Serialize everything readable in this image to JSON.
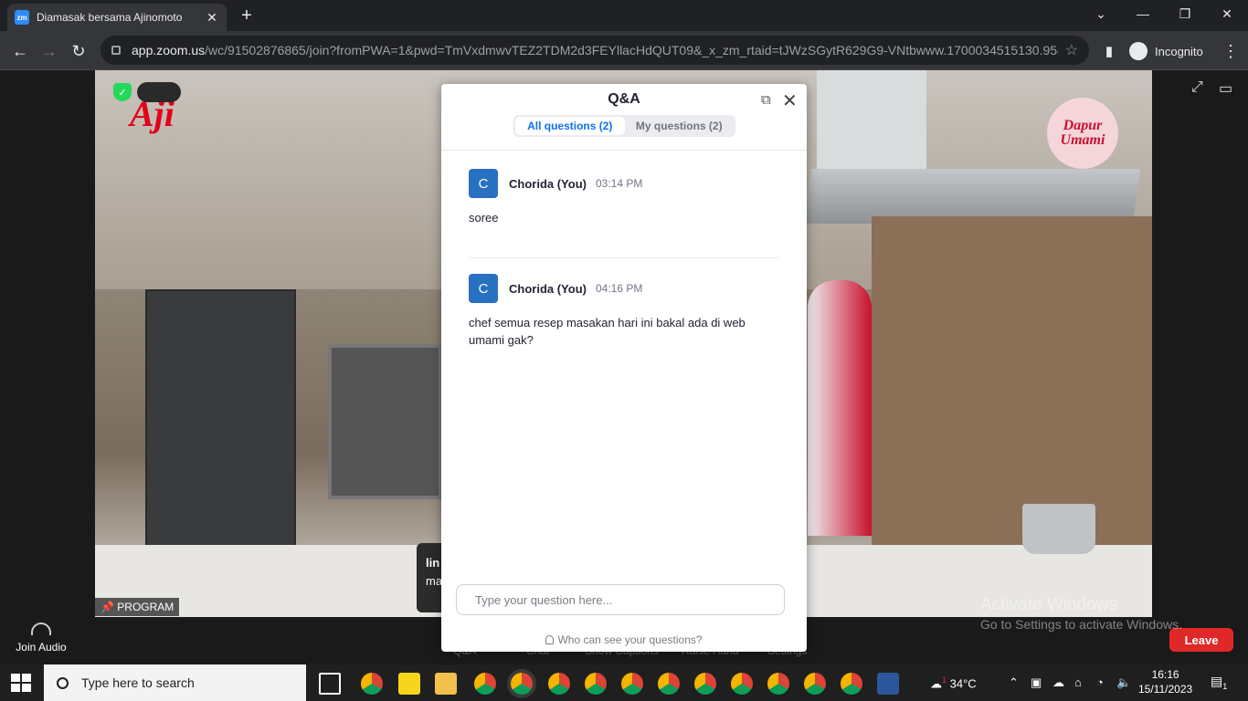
{
  "browser": {
    "tab_title": "Diamasak bersama Ajinomoto",
    "tab_favicon": "zm",
    "url_host": "app.zoom.us",
    "url_rest": "/wc/91502876865/join?fromPWA=1&pwd=TmVxdmwvTEZ2TDM2d3FEYllacHdQUT09&_x_zm_rtaid=tJWzSGytR629G9-VNtbwww.1700034515130.9542...",
    "profile_label": "Incognito"
  },
  "video": {
    "badge_label": "PROGRAM",
    "logo_left": "Aji",
    "logo_right": "Dapur Umami",
    "chat_preview_line1": "lin",
    "chat_preview_line2": "ma"
  },
  "watermark": {
    "line1": "Activate Windows",
    "line2": "Go to Settings to activate Windows."
  },
  "qa": {
    "title": "Q&A",
    "tab_all": "All questions (2)",
    "tab_mine": "My questions (2)",
    "questions": [
      {
        "avatar": "C",
        "name": "Chorida (You)",
        "time": "03:14 PM",
        "text": "soree"
      },
      {
        "avatar": "C",
        "name": "Chorida (You)",
        "time": "04:16 PM",
        "text": "chef semua resep masakan hari ini bakal ada di web umami gak?"
      }
    ],
    "input_placeholder": "Type your question here...",
    "footer_note": "Who can see your questions?"
  },
  "zoombar": {
    "join_audio": "Join Audio",
    "items": [
      "Q&A",
      "Chat",
      "Show Captions",
      "Raise Hand",
      "Settings"
    ],
    "leave": "Leave"
  },
  "taskbar": {
    "search_placeholder": "Type here to search",
    "weather": "34°C",
    "weather_badge": "1",
    "time": "16:16",
    "date": "15/11/2023",
    "notif_count": "1"
  },
  "colors": {
    "zoom_blue": "#0e72ed",
    "avatar_blue": "#2870c2",
    "leave_red": "#e02828"
  }
}
